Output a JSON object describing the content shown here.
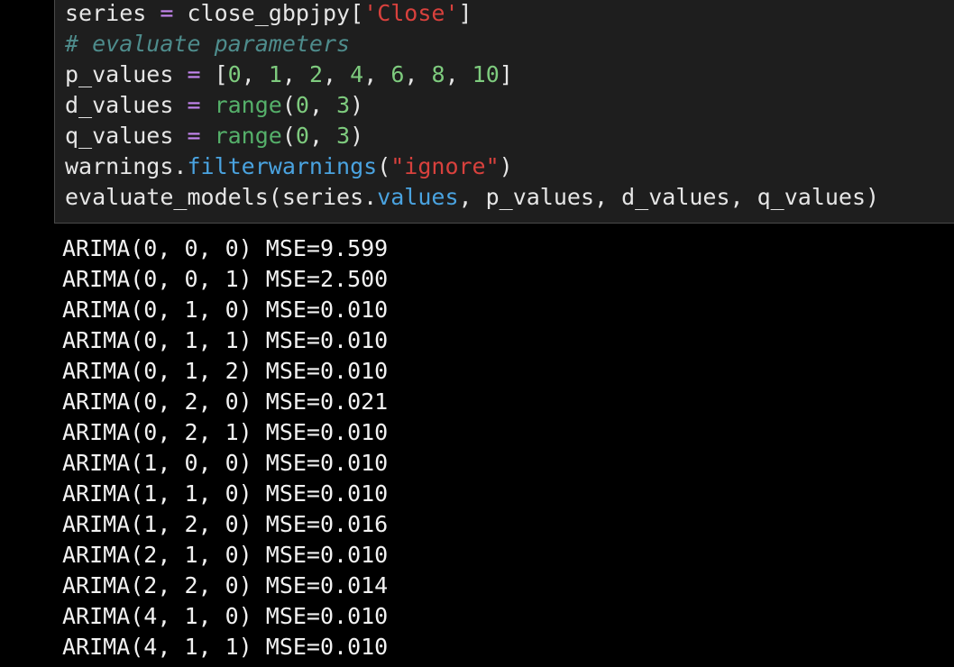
{
  "colors": {
    "background": "#000000",
    "cell_background": "#1e1e1e",
    "cell_border": "#4a4a4a",
    "text": "#e6e6e6",
    "operator": "#c586f0",
    "string": "#d8413d",
    "number": "#7ecb7e",
    "comment": "#4e8c8c",
    "builtin": "#55b06a",
    "attribute": "#4aa3e0"
  },
  "code": {
    "line1": {
      "var": "series",
      "op": " = ",
      "obj": "close_gbpjpy[",
      "str": "'Close'",
      "end": "]"
    },
    "line2": {
      "comment": "# evaluate parameters"
    },
    "line3": {
      "var": "p_values",
      "op": " = ",
      "open": "[",
      "n1": "0",
      "n2": "1",
      "n3": "2",
      "n4": "4",
      "n5": "6",
      "n6": "8",
      "n7": "10",
      "sep": ", ",
      "close": "]"
    },
    "line4": {
      "var": "d_values",
      "op": " = ",
      "fn": "range",
      "open": "(",
      "a": "0",
      "sep": ", ",
      "b": "3",
      "close": ")"
    },
    "line5": {
      "var": "q_values",
      "op": " = ",
      "fn": "range",
      "open": "(",
      "a": "0",
      "sep": ", ",
      "b": "3",
      "close": ")"
    },
    "line6": {
      "obj": "warnings.",
      "method": "filterwarnings",
      "open": "(",
      "str": "\"ignore\"",
      "close": ")"
    },
    "line7": {
      "call": "evaluate_models(series.",
      "attr": "values",
      "rest": ", p_values, d_values, q_values)"
    }
  },
  "output": {
    "lines": [
      "ARIMA(0, 0, 0) MSE=9.599",
      "ARIMA(0, 0, 1) MSE=2.500",
      "ARIMA(0, 1, 0) MSE=0.010",
      "ARIMA(0, 1, 1) MSE=0.010",
      "ARIMA(0, 1, 2) MSE=0.010",
      "ARIMA(0, 2, 0) MSE=0.021",
      "ARIMA(0, 2, 1) MSE=0.010",
      "ARIMA(1, 0, 0) MSE=0.010",
      "ARIMA(1, 1, 0) MSE=0.010",
      "ARIMA(1, 2, 0) MSE=0.016",
      "ARIMA(2, 1, 0) MSE=0.010",
      "ARIMA(2, 2, 0) MSE=0.014",
      "ARIMA(4, 1, 0) MSE=0.010",
      "ARIMA(4, 1, 1) MSE=0.010"
    ]
  }
}
